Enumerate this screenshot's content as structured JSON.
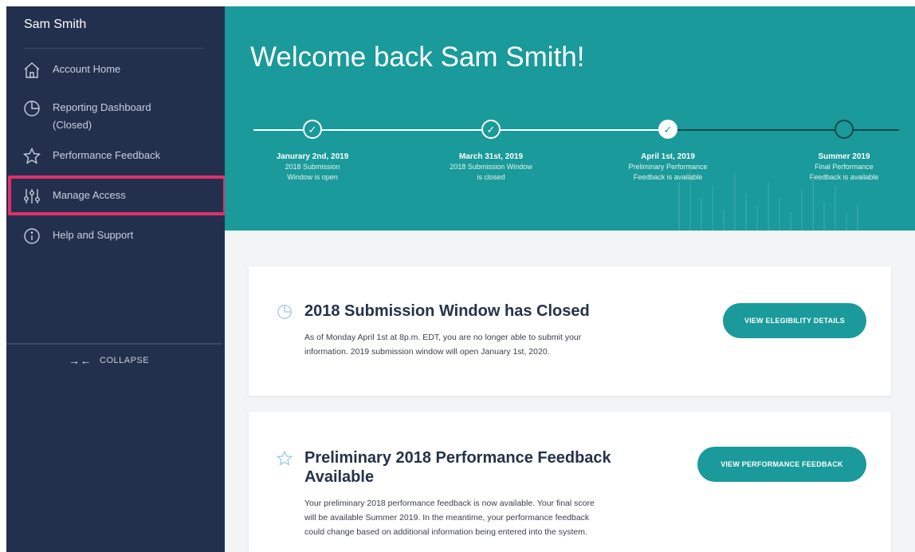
{
  "sidebar": {
    "user_name": "Sam Smith",
    "items": [
      {
        "label": "Account Home",
        "icon": "home-icon"
      },
      {
        "label_line1": "Reporting Dashboard",
        "label_line2": "(Closed)",
        "icon": "pie-chart-icon"
      },
      {
        "label": "Performance Feedback",
        "icon": "star-icon"
      },
      {
        "label": "Manage Access",
        "icon": "sliders-icon"
      },
      {
        "label": "Help and Support",
        "icon": "info-icon"
      }
    ],
    "collapse_label": "COLLAPSE",
    "collapse_arrows": "→←"
  },
  "banner": {
    "welcome": "Welcome back Sam Smith!",
    "milestones": [
      {
        "date": "Janurary 2nd, 2019",
        "line1": "2018 Submission",
        "line2": "Window is open",
        "state": "complete"
      },
      {
        "date": "March 31st, 2019",
        "line1": "2018 Submission Window",
        "line2": "is closed",
        "state": "complete"
      },
      {
        "date": "April 1st, 2019",
        "line1": "Preliminary Performance",
        "line2": "Feedback is available",
        "state": "current"
      },
      {
        "date": "Summer 2019",
        "line1": "Final Performance",
        "line2": "Feedback is available",
        "state": "upcoming"
      }
    ]
  },
  "cards": [
    {
      "icon": "clock-icon",
      "title": "2018 Submission Window has Closed",
      "text_line1": "As of Monday April 1st at 8p.m. EDT, you are no longer able to submit your",
      "text_line2": "information. 2019 submission window will open January 1st, 2020.",
      "button": "VIEW ELEGIBILITY DETAILS"
    },
    {
      "icon": "star-icon",
      "title_line1": "Preliminary 2018 Performance Feedback",
      "title_line2": "Available",
      "text_line1": "Your preliminary 2018 performance feedback is now available. Your final score",
      "text_line2": "will be available Summer 2019.  In the meantime, your performance feedback",
      "text_line3": "could change based on additional information being entered into the system.",
      "button": "VIEW PERFORMANCE FEEDBACK"
    }
  ],
  "colors": {
    "sidebar_bg": "#23304d",
    "teal": "#1a9a9a",
    "highlight": "#e0306a"
  }
}
